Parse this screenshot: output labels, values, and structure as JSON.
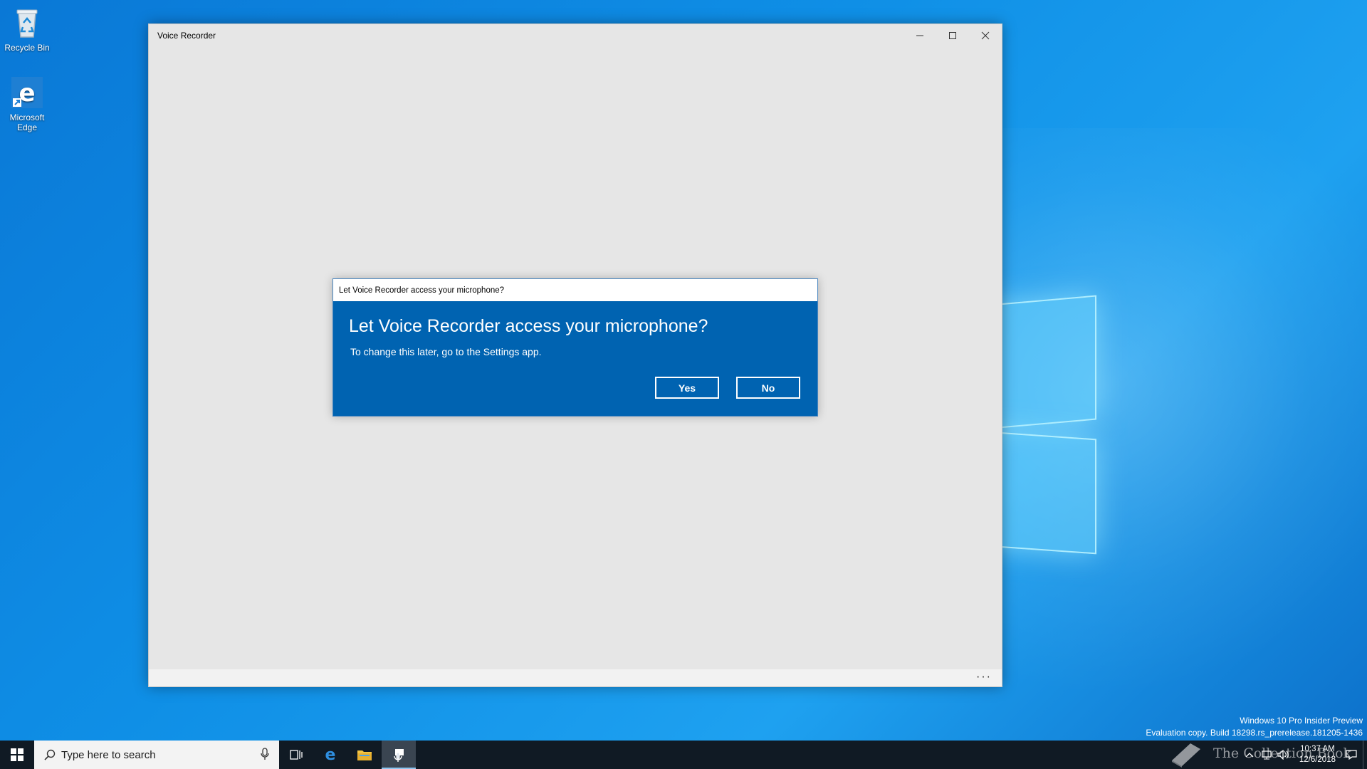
{
  "desktop": {
    "icons": [
      {
        "label": "Recycle Bin"
      },
      {
        "label": "Microsoft Edge"
      }
    ]
  },
  "window": {
    "title": "Voice Recorder",
    "controls": {
      "minimize": "—",
      "maximize": "☐",
      "close": "✕"
    },
    "footer_more": "···"
  },
  "dialog": {
    "window_title": "Let Voice Recorder access your microphone?",
    "heading": "Let Voice Recorder access your microphone?",
    "subtext": "To change this later, go to the Settings app.",
    "yes_label": "Yes",
    "no_label": "No"
  },
  "watermark": {
    "line1": "Windows 10 Pro Insider Preview",
    "line2": "Evaluation copy. Build 18298.rs_prerelease.181205-1436"
  },
  "taskbar": {
    "search_placeholder": "Type here to search",
    "clock_time": "10:37 AM",
    "clock_date": "12/6/2018",
    "overlay_logo_text": "The Collection Book"
  },
  "colors": {
    "dialog_bg": "#0063b1",
    "taskbar_bg": "#101a24",
    "desktop_bg": "#0a78d6"
  }
}
